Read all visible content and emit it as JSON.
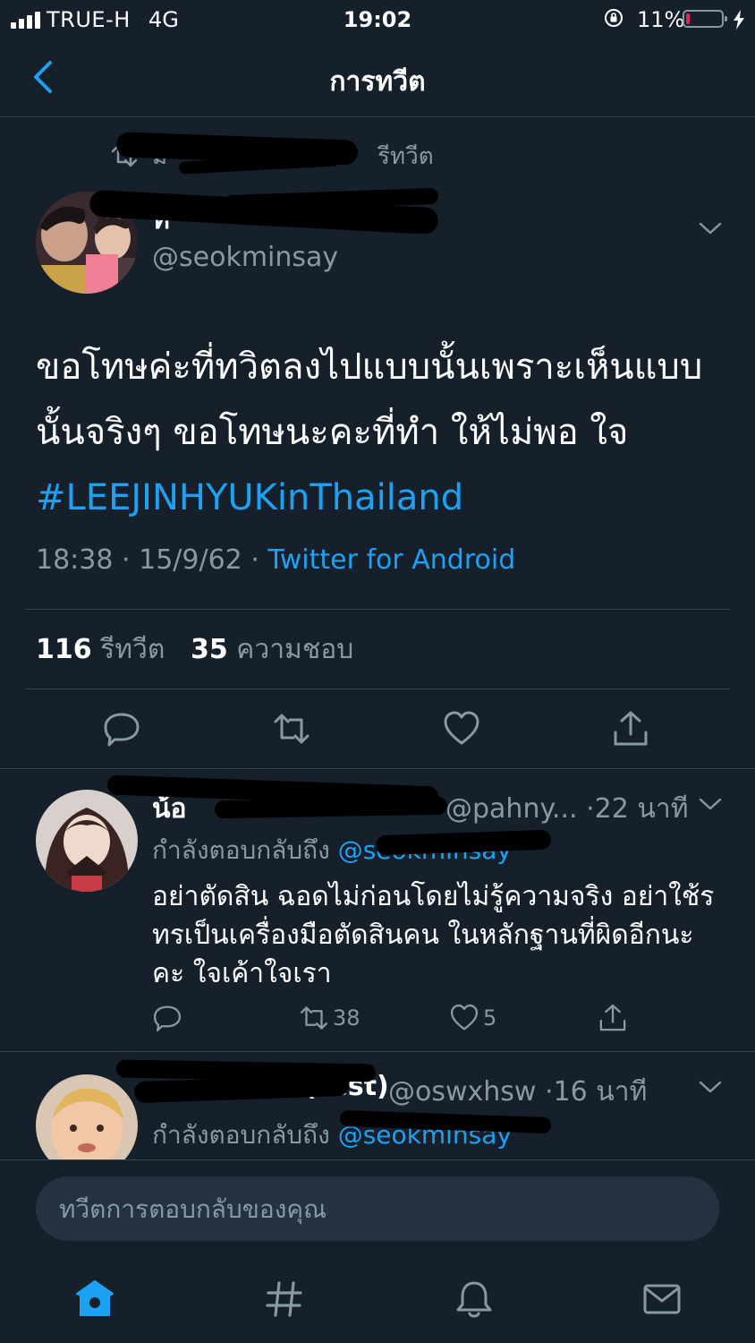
{
  "status_bar": {
    "carrier": "TRUE-H",
    "network": "4G",
    "time": "19:02",
    "battery_percent": "11%",
    "battery_level": 0.11,
    "icons": [
      "signal-icon",
      "orientation-lock-icon",
      "battery-icon",
      "charging-icon"
    ],
    "battery_color": "#e0245e"
  },
  "header": {
    "title": "การทวีต",
    "back_icon": "chevron-left-icon"
  },
  "tweet": {
    "retweet_label": "รีทวีต",
    "retweeter": "ม",
    "author_name": "ทิ",
    "handle": "@seokminsay",
    "text": "ขอโทษค่ะที่ทวิตลงไปแบบนั้นเพราะเห็นแบบนั้นจริงๆ ขอโทษนะคะที่ทำ ให้ไม่พอ ใจ ",
    "hashtag": "#LEEJINHYUKinThailand",
    "time": "18:38",
    "date": "15/9/62",
    "separator": "·",
    "source": "Twitter for Android",
    "retweet_count": "116",
    "retweet_count_label": "รีทวีต",
    "like_count": "35",
    "like_count_label": "ความชอบ"
  },
  "actions": [
    "reply-icon",
    "retweet-icon",
    "like-icon",
    "share-icon"
  ],
  "replies": [
    {
      "name": "น้อ",
      "handle": "@pahny...",
      "time": "22 นาที",
      "replying_to_label": "กำลังตอบกลับถึง",
      "replying_to": "@seokminsay",
      "text": "อย่าตัดสิน ฉอดไม่ก่อนโดยไม่รู้ความจริง อย่าใช้รทรเป็นเครื่องมือตัดสินคน ในหลักฐานที่ผิดอีกนะคะ ใจเค้าใจเรา",
      "retweets": "38",
      "likes": "5"
    },
    {
      "name": "(rest)",
      "handle": "@oswxhsw",
      "time": "16 นาที",
      "replying_to_label": "กำลังตอบกลับถึง",
      "replying_to": "@seokminsay"
    }
  ],
  "composer": {
    "placeholder": "ทวีตการตอบกลับของคุณ"
  },
  "tab_bar": [
    "home-icon",
    "explore-icon",
    "notifications-icon",
    "messages-icon"
  ],
  "colors": {
    "background": "#15202b",
    "accent": "#1da1f2",
    "secondary_text": "#8899a6",
    "divider": "#38444d"
  }
}
